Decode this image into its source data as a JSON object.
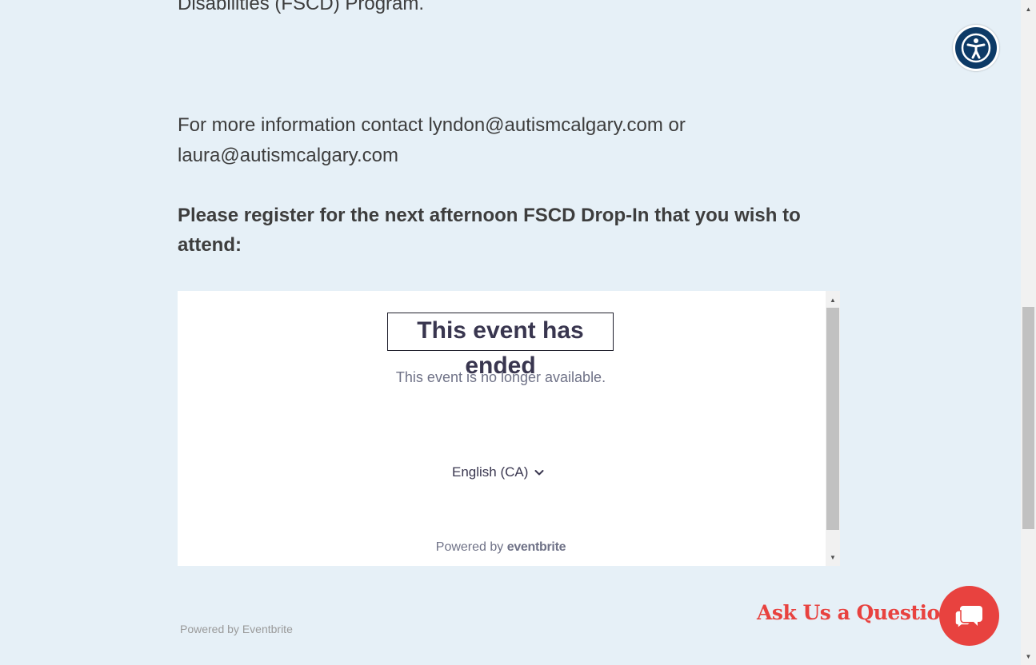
{
  "article": {
    "intro_tail": "Disabilities (FSCD) Program.",
    "contact_line_1": "For more information contact lyndon@autismcalgary.com or",
    "contact_line_2": "laura@autismcalgary.com",
    "register_line_1": "Please register for the next afternoon FSCD Drop-In that you wish to",
    "register_line_2": "attend:"
  },
  "embed": {
    "title": "This event has ended",
    "subtitle": "This event is no longer available.",
    "language": "English (CA)",
    "powered_prefix": "Powered by",
    "powered_brand": "eventbrite",
    "scroll_up_icon": "▲",
    "scroll_down_icon": "▼"
  },
  "footer": {
    "powered_text": "Powered by Eventbrite"
  },
  "widgets": {
    "ask_label": "Ask Us a Question",
    "accessibility_icon": "accessibility-icon",
    "chat_icon": "chat-bubbles-icon"
  },
  "scrollbar": {
    "up_icon": "▲",
    "down_icon": "▼"
  },
  "colors": {
    "page_background": "#e6f0f7",
    "text": "#3d3d3d",
    "accent_red": "#e8423f",
    "accessibility_navy": "#0d3a66"
  }
}
